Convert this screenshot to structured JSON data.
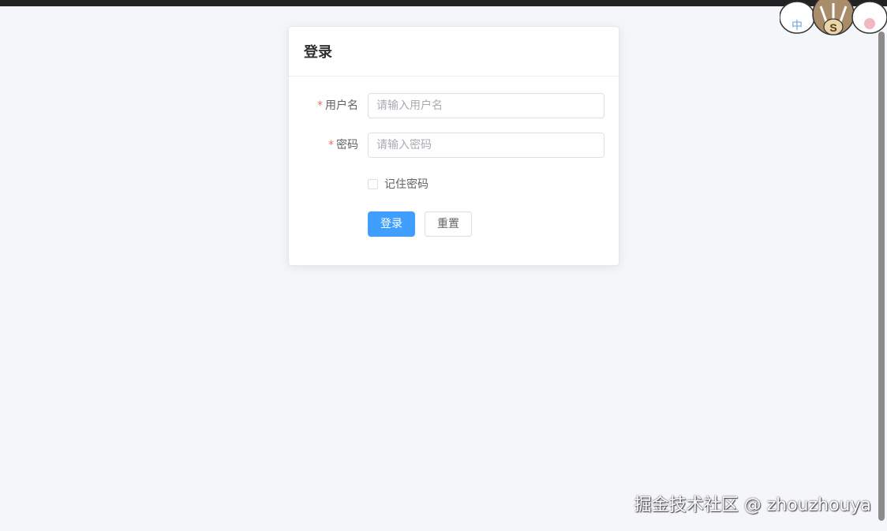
{
  "card": {
    "title": "登录"
  },
  "form": {
    "username": {
      "label": "用户名",
      "required_mark": "*",
      "placeholder": "请输入用户名",
      "value": ""
    },
    "password": {
      "label": "密码",
      "required_mark": "*",
      "placeholder": "请输入密码",
      "value": ""
    },
    "remember": {
      "label": "记住密码",
      "checked": false
    },
    "login_button": "登录",
    "reset_button": "重置"
  },
  "overlay": {
    "mascot_badges": [
      "中",
      "S"
    ],
    "watermark": "掘金技术社区 @ zhouzhouya"
  },
  "colors": {
    "primary": "#409eff",
    "required": "#f56c6c",
    "background": "#f5f6fa"
  }
}
